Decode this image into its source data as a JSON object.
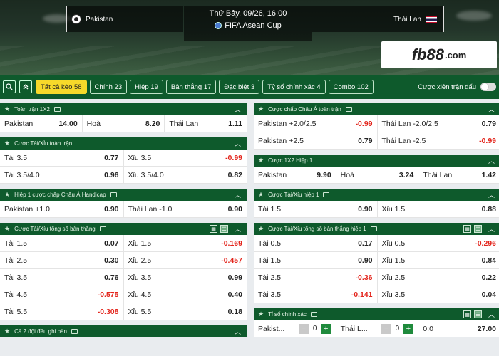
{
  "header": {
    "home_team": "Pakistan",
    "away_team": "Thái Lan",
    "datetime": "Thứ Bảy, 09/26, 16:00",
    "competition": "FIFA Asean Cup",
    "logo_main": "fb88",
    "logo_suffix": ".com"
  },
  "toolbar": {
    "tabs": [
      {
        "label": "Tất cả kèo 58",
        "active": true
      },
      {
        "label": "Chính 23"
      },
      {
        "label": "Hiệp 19"
      },
      {
        "label": "Bàn thắng 17"
      },
      {
        "label": "Đặc biệt 3"
      },
      {
        "label": "Tỷ số chính xác 4"
      },
      {
        "label": "Combo 102"
      }
    ],
    "parlay_label": "Cược xiên trận đấu"
  },
  "left": {
    "p1": {
      "title": "Toàn trận 1X2",
      "rows": [
        [
          [
            "Pakistan",
            "14.00"
          ],
          [
            "Hoà",
            "8.20"
          ],
          [
            "Thái Lan",
            "1.11"
          ]
        ]
      ]
    },
    "p2": {
      "title": "Cược Tài/Xỉu toàn trận",
      "rows": [
        [
          [
            "Tài 3.5",
            "0.77"
          ],
          [
            "Xỉu 3.5",
            "-0.99"
          ]
        ],
        [
          [
            "Tài 3.5/4.0",
            "0.96"
          ],
          [
            "Xỉu 3.5/4.0",
            "0.82"
          ]
        ]
      ]
    },
    "p3": {
      "title": "Hiệp 1 cược chấp Châu Á Handicap",
      "rows": [
        [
          [
            "Pakistan +1.0",
            "0.90"
          ],
          [
            "Thái Lan -1.0",
            "0.90"
          ]
        ]
      ]
    },
    "p4": {
      "title": "Cược Tài/Xỉu tổng số bàn thắng",
      "rows": [
        [
          [
            "Tài 1.5",
            "0.07"
          ],
          [
            "Xỉu 1.5",
            "-0.169"
          ]
        ],
        [
          [
            "Tài 2.5",
            "0.30"
          ],
          [
            "Xỉu 2.5",
            "-0.457"
          ]
        ],
        [
          [
            "Tài 3.5",
            "0.76"
          ],
          [
            "Xỉu 3.5",
            "0.99"
          ]
        ],
        [
          [
            "Tài 4.5",
            "-0.575"
          ],
          [
            "Xỉu 4.5",
            "0.40"
          ]
        ],
        [
          [
            "Tài 5.5",
            "-0.308"
          ],
          [
            "Xỉu 5.5",
            "0.18"
          ]
        ]
      ]
    },
    "p5": {
      "title": "Cả 2 đội đều ghi bàn"
    }
  },
  "right": {
    "p1": {
      "title": "Cược chấp Châu Á toàn trận",
      "rows": [
        [
          [
            "Pakistan +2.0/2.5",
            "-0.99"
          ],
          [
            "Thái Lan -2.0/2.5",
            "0.79"
          ]
        ],
        [
          [
            "Pakistan +2.5",
            "0.79"
          ],
          [
            "Thái Lan -2.5",
            "-0.99"
          ]
        ]
      ]
    },
    "p2": {
      "title": "Cược 1X2 Hiệp 1",
      "rows": [
        [
          [
            "Pakistan",
            "9.90"
          ],
          [
            "Hoà",
            "3.24"
          ],
          [
            "Thái Lan",
            "1.42"
          ]
        ]
      ]
    },
    "p3": {
      "title": "Cược Tài/Xỉu hiệp 1",
      "rows": [
        [
          [
            "Tài 1.5",
            "0.90"
          ],
          [
            "Xỉu 1.5",
            "0.88"
          ]
        ]
      ]
    },
    "p4": {
      "title": "Cược Tài/Xỉu tổng số bàn thắng hiệp 1",
      "rows": [
        [
          [
            "Tài 0.5",
            "0.17"
          ],
          [
            "Xỉu 0.5",
            "-0.296"
          ]
        ],
        [
          [
            "Tài 1.5",
            "0.90"
          ],
          [
            "Xỉu 1.5",
            "0.84"
          ]
        ],
        [
          [
            "Tài 2.5",
            "-0.36"
          ],
          [
            "Xỉu 2.5",
            "0.22"
          ]
        ],
        [
          [
            "Tài 3.5",
            "-0.141"
          ],
          [
            "Xỉu 3.5",
            "0.04"
          ]
        ]
      ]
    },
    "p5": {
      "title": "Tỉ số chính xác",
      "home_short": "Pakist...",
      "home_value": "0",
      "away_short": "Thái L...",
      "away_value": "0",
      "score": "0:0",
      "score_odd": "27.00"
    }
  },
  "colors": {
    "header_green": "#0e5a2c",
    "active_tab": "#f7d92a",
    "negative": "#e3241b",
    "plus_green": "#1f8a3c"
  }
}
